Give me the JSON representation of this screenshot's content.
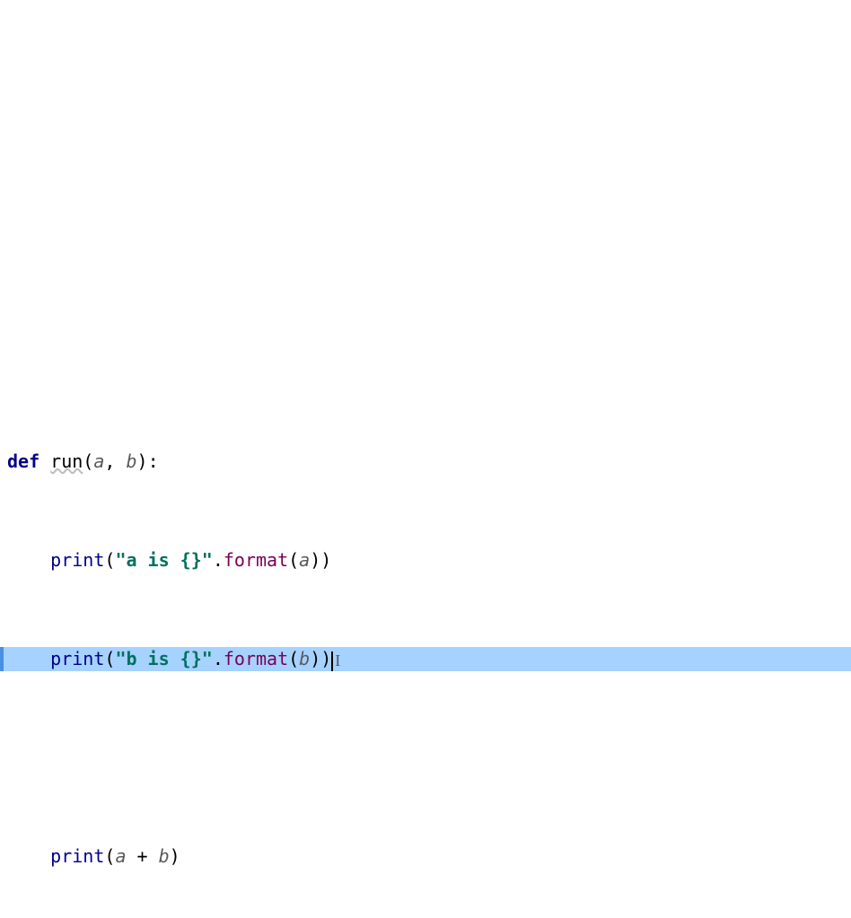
{
  "code": {
    "line1": {
      "kw": "def",
      "space1": " ",
      "fn": "run",
      "open": "(",
      "pA": "a",
      "comma": ", ",
      "pB": "b",
      "close": ")",
      "colon": ":"
    },
    "line2": {
      "indent": "    ",
      "builtin": "print",
      "open": "(",
      "str": "\"a is {}\"",
      "dot": ".",
      "method": "format",
      "open2": "(",
      "arg": "a",
      "close2": ")",
      "close": ")"
    },
    "line3": {
      "indent": "    ",
      "builtin": "print",
      "open": "(",
      "str": "\"b is {}\"",
      "dot": ".",
      "method": "format",
      "open2": "(",
      "arg": "b",
      "close2": ")",
      "close": ")"
    },
    "line5": {
      "indent": "    ",
      "builtin": "print",
      "open": "(",
      "a": "a",
      "op": " + ",
      "b": "b",
      "close": ")"
    }
  }
}
